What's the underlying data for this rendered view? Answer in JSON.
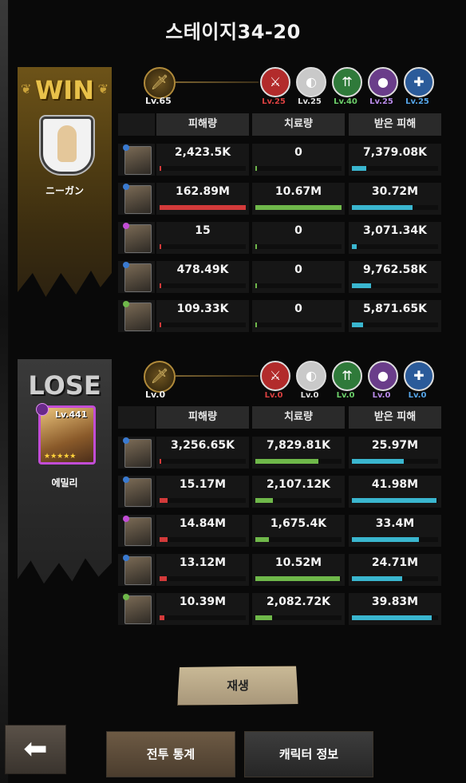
{
  "title": "스테이지34-20",
  "win_team": {
    "result": "WIN",
    "character_name": "ニーガン",
    "leader_lv": "Lv.65",
    "buffs": [
      {
        "icon": "axes-icon",
        "lv": "Lv.25",
        "color": "#b22b2b",
        "lv_color": "#d94040"
      },
      {
        "icon": "shield-icon",
        "lv": "Lv.25",
        "color": "#c9c9c9",
        "lv_color": "#e0e0e0"
      },
      {
        "icon": "arrows-icon",
        "lv": "Lv.40",
        "color": "#2f7a3a",
        "lv_color": "#6ccf6a"
      },
      {
        "icon": "grenade-icon",
        "lv": "Lv.25",
        "color": "#6a3d8a",
        "lv_color": "#b88ae8"
      },
      {
        "icon": "medic-cross-icon",
        "lv": "Lv.25",
        "color": "#2b5b9a",
        "lv_color": "#55a5e8"
      }
    ],
    "rows": [
      {
        "damage": "2,423.5K",
        "heal": "0",
        "taken": "7,379.08K",
        "damage_pct": 0.01,
        "heal_pct": 0,
        "taken_pct": 0.17
      },
      {
        "damage": "162.89M",
        "heal": "10.67M",
        "taken": "30.72M",
        "damage_pct": 1.0,
        "heal_pct": 1.0,
        "taken_pct": 0.7
      },
      {
        "damage": "15",
        "heal": "0",
        "taken": "3,071.34K",
        "damage_pct": 0,
        "heal_pct": 0,
        "taken_pct": 0.06
      },
      {
        "damage": "478.49K",
        "heal": "0",
        "taken": "9,762.58K",
        "damage_pct": 0.003,
        "heal_pct": 0,
        "taken_pct": 0.22
      },
      {
        "damage": "109.33K",
        "heal": "0",
        "taken": "5,871.65K",
        "damage_pct": 0.001,
        "heal_pct": 0,
        "taken_pct": 0.13
      }
    ]
  },
  "lose_team": {
    "result": "LOSE",
    "character_name": "에밀리",
    "character_lv": "Lv.441",
    "character_stars": "★★★★★",
    "leader_lv": "Lv.0",
    "buffs": [
      {
        "icon": "axes-icon",
        "lv": "Lv.0",
        "color": "#b22b2b",
        "lv_color": "#d94040"
      },
      {
        "icon": "shield-icon",
        "lv": "Lv.0",
        "color": "#c9c9c9",
        "lv_color": "#e0e0e0"
      },
      {
        "icon": "arrows-icon",
        "lv": "Lv.0",
        "color": "#2f7a3a",
        "lv_color": "#6ccf6a"
      },
      {
        "icon": "grenade-icon",
        "lv": "Lv.0",
        "color": "#6a3d8a",
        "lv_color": "#b88ae8"
      },
      {
        "icon": "medic-cross-icon",
        "lv": "Lv.0",
        "color": "#2b5b9a",
        "lv_color": "#55a5e8"
      }
    ],
    "rows": [
      {
        "damage": "3,256.65K",
        "heal": "7,829.81K",
        "taken": "25.97M",
        "damage_pct": 0.02,
        "heal_pct": 0.73,
        "taken_pct": 0.6
      },
      {
        "damage": "15.17M",
        "heal": "2,107.12K",
        "taken": "41.98M",
        "damage_pct": 0.09,
        "heal_pct": 0.2,
        "taken_pct": 0.98
      },
      {
        "damage": "14.84M",
        "heal": "1,675.4K",
        "taken": "33.4M",
        "damage_pct": 0.09,
        "heal_pct": 0.16,
        "taken_pct": 0.78
      },
      {
        "damage": "13.12M",
        "heal": "10.52M",
        "taken": "24.71M",
        "damage_pct": 0.08,
        "heal_pct": 0.98,
        "taken_pct": 0.58
      },
      {
        "damage": "10.39M",
        "heal": "2,082.72K",
        "taken": "39.83M",
        "damage_pct": 0.06,
        "heal_pct": 0.19,
        "taken_pct": 0.93
      }
    ]
  },
  "headers": {
    "damage": "피해량",
    "heal": "치료량",
    "taken": "받은 피해"
  },
  "buttons": {
    "replay": "재생",
    "battle_stats": "전투 통계",
    "character_info": "캐릭터 정보"
  },
  "colors": {
    "damage_bar": "#d33a3a",
    "heal_bar": "#6fb84a",
    "taken_bar": "#3ab6cf"
  }
}
